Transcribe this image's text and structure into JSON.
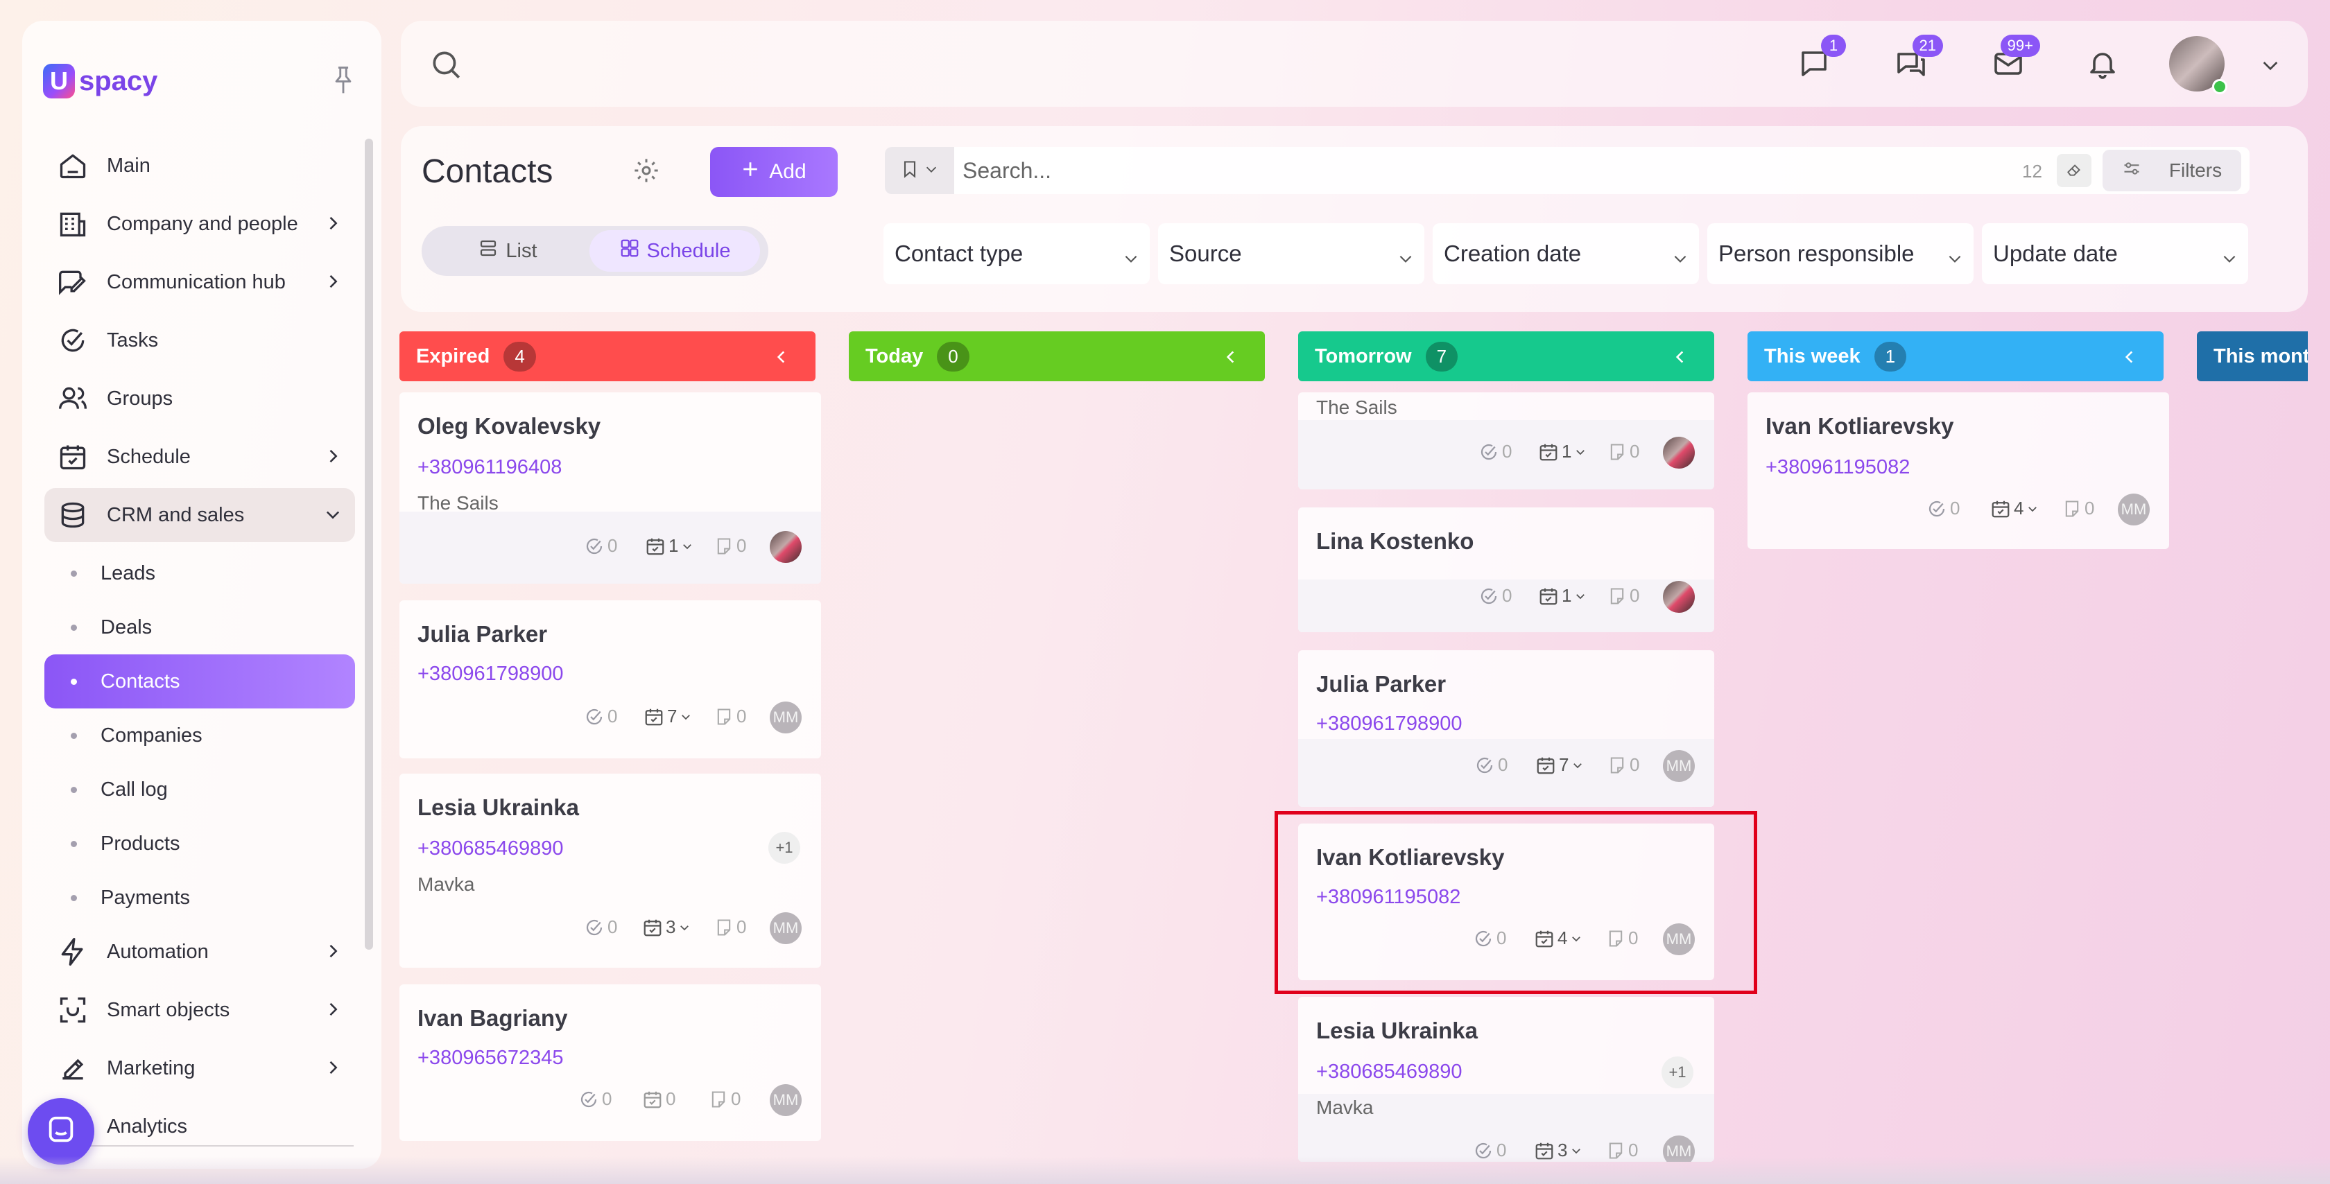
{
  "app": {
    "logo_text": "spacy",
    "logo_mark": "U"
  },
  "sidebar": {
    "items": [
      {
        "label": "Main",
        "icon": "home-icon",
        "has_chevron": false
      },
      {
        "label": "Company and people",
        "icon": "building-icon",
        "has_chevron": true
      },
      {
        "label": "Communication hub",
        "icon": "chat-edit-icon",
        "has_chevron": true
      },
      {
        "label": "Tasks",
        "icon": "check-circle-icon",
        "has_chevron": false
      },
      {
        "label": "Groups",
        "icon": "people-icon",
        "has_chevron": false
      },
      {
        "label": "Schedule",
        "icon": "calendar-check-icon",
        "has_chevron": true
      },
      {
        "label": "CRM and sales",
        "icon": "database-icon",
        "has_chevron": true,
        "expanded": true
      }
    ],
    "crm_sub": [
      {
        "label": "Leads"
      },
      {
        "label": "Deals"
      },
      {
        "label": "Contacts",
        "active": true
      },
      {
        "label": "Companies"
      },
      {
        "label": "Call log"
      },
      {
        "label": "Products"
      },
      {
        "label": "Payments"
      }
    ],
    "items_after": [
      {
        "label": "Automation",
        "icon": "lightning-icon"
      },
      {
        "label": "Smart objects",
        "icon": "smart-object-icon"
      },
      {
        "label": "Marketing",
        "icon": "marketing-icon"
      },
      {
        "label": "Analytics",
        "icon": "analytics-icon"
      }
    ]
  },
  "topbar": {
    "badges": {
      "messages": "1",
      "chats": "21",
      "mail": "99+"
    }
  },
  "page": {
    "title": "Contacts",
    "add_label": "Add",
    "views": {
      "list": "List",
      "schedule": "Schedule",
      "active": "Schedule"
    },
    "search": {
      "placeholder": "Search...",
      "count": "12"
    },
    "filters_label": "Filters",
    "dropdowns": [
      "Contact type",
      "Source",
      "Creation date",
      "Person responsible",
      "Update date"
    ]
  },
  "colors": {
    "expired": "#ff4d4d",
    "today": "#66cc22",
    "tomorrow": "#16c98d",
    "this_week": "#33b1f5",
    "this_month": "#1f6fa8",
    "accent": "#8b56f6"
  },
  "columns": [
    {
      "title": "Expired",
      "count": "4",
      "cards": [
        {
          "name": "Oleg Kovalevsky",
          "phone": "+380961196408",
          "company": "The Sails",
          "tasks": "0",
          "events": "1",
          "comments": "0",
          "avatar": "photo"
        },
        {
          "name": "Julia Parker",
          "phone": "+380961798900",
          "tasks": "0",
          "events": "7",
          "comments": "0",
          "avatar": "MM"
        },
        {
          "name": "Lesia Ukrainka",
          "phone": "+380685469890",
          "company": "Mavka",
          "extra": "+1",
          "tasks": "0",
          "events": "3",
          "comments": "0",
          "avatar": "MM"
        },
        {
          "name": "Ivan Bagriany",
          "phone": "+380965672345",
          "tasks": "0",
          "events": "0",
          "comments": "0",
          "avatar": "MM"
        }
      ]
    },
    {
      "title": "Today",
      "count": "0",
      "cards": []
    },
    {
      "title": "Tomorrow",
      "count": "7",
      "cards": [
        {
          "company": "The Sails",
          "tasks": "0",
          "events": "1",
          "comments": "0",
          "avatar": "photo"
        },
        {
          "name": "Lina Kostenko",
          "tasks": "0",
          "events": "1",
          "comments": "0",
          "avatar": "photo"
        },
        {
          "name": "Julia Parker",
          "phone": "+380961798900",
          "tasks": "0",
          "events": "7",
          "comments": "0",
          "avatar": "MM"
        },
        {
          "name": "Ivan Kotliarevsky",
          "phone": "+380961195082",
          "tasks": "0",
          "events": "4",
          "comments": "0",
          "avatar": "MM"
        },
        {
          "name": "Lesia Ukrainka",
          "phone": "+380685469890",
          "company": "Mavka",
          "extra": "+1",
          "tasks": "0",
          "events": "3",
          "comments": "0",
          "avatar": "MM"
        }
      ]
    },
    {
      "title": "This week",
      "count": "1",
      "cards": [
        {
          "name": "Ivan Kotliarevsky",
          "phone": "+380961195082",
          "tasks": "0",
          "events": "4",
          "comments": "0",
          "avatar": "MM"
        }
      ]
    },
    {
      "title": "This mont",
      "count": "",
      "cards": []
    }
  ]
}
